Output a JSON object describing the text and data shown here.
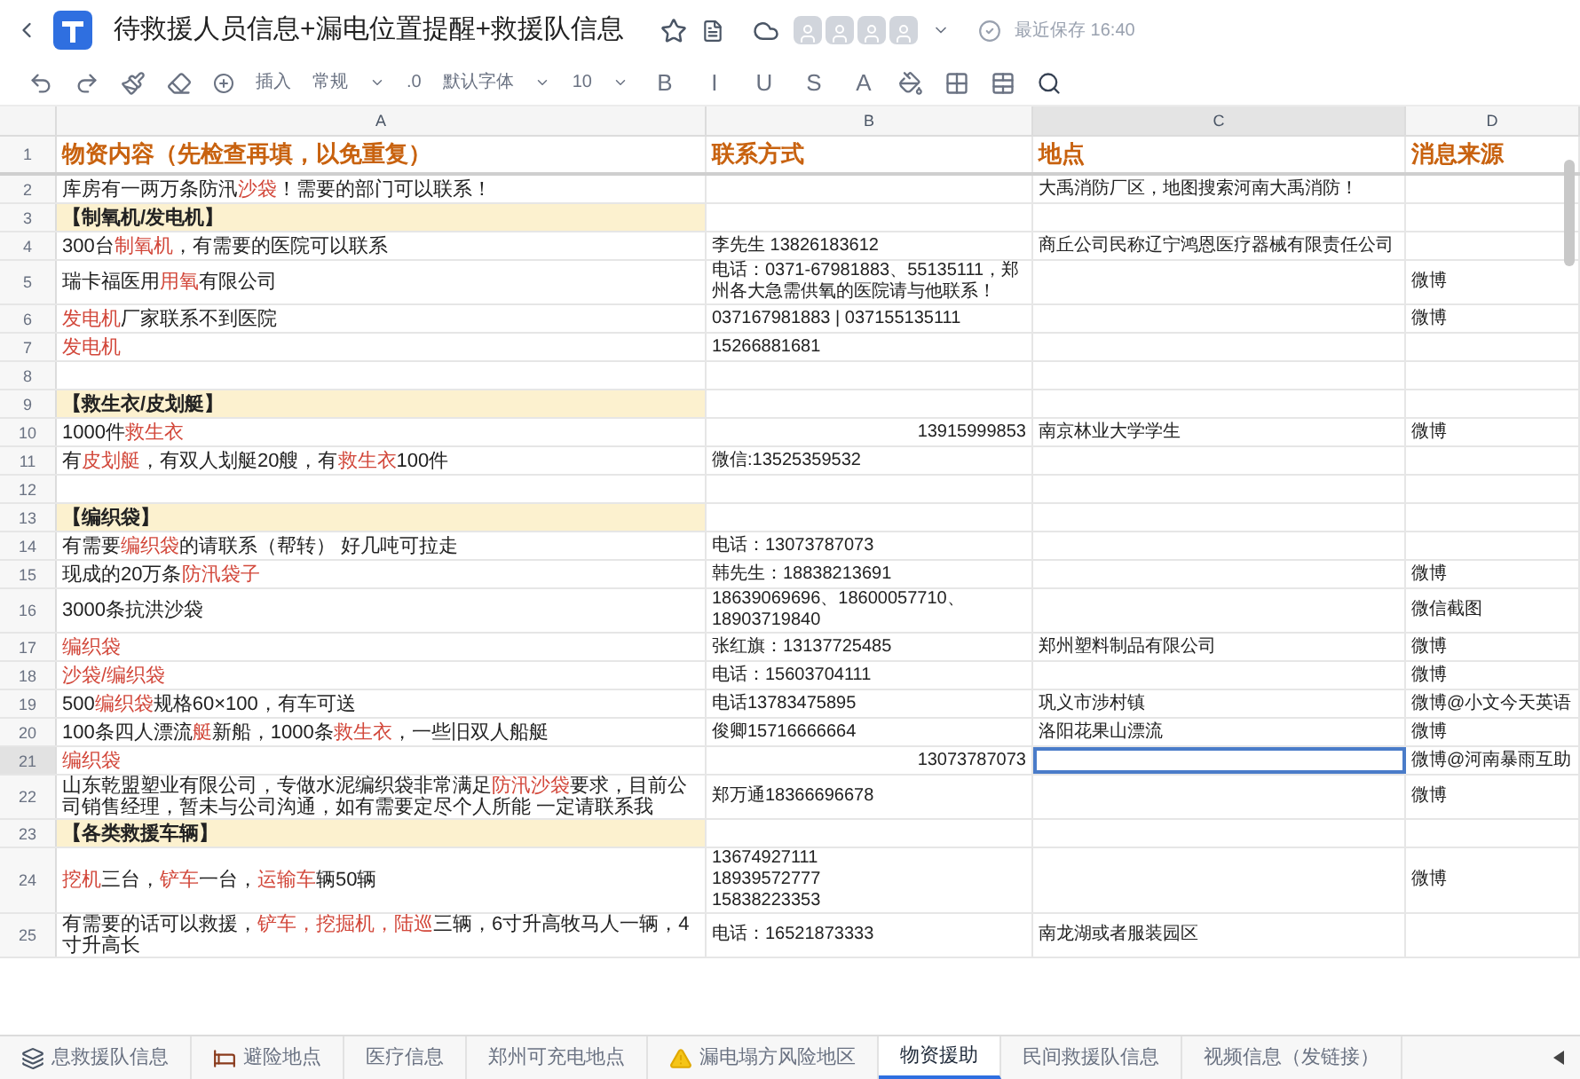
{
  "document": {
    "title": "待救援人员信息+漏电位置提醒+救援队信息",
    "save_status": "最近保存 16:40"
  },
  "toolbar": {
    "disabled": true,
    "insert": "插入",
    "number_format": "常规",
    "decimal": ".0",
    "font": "默认字体",
    "font_size": "10",
    "format_letters": [
      "B",
      "I",
      "U",
      "S",
      "A"
    ]
  },
  "columns": [
    {
      "letter": "A",
      "selected": false
    },
    {
      "letter": "B",
      "selected": false
    },
    {
      "letter": "C",
      "selected": true
    },
    {
      "letter": "D",
      "selected": false
    }
  ],
  "rows": [
    {
      "number": "1",
      "kind": "header",
      "selected": false,
      "a": "物资内容（先检查再填，以免重复）",
      "b": "联系方式",
      "c": "地点",
      "d": "消息来源"
    },
    {
      "number": "2",
      "kind": "plain",
      "selected": false,
      "a": [
        {
          "text": "库房有一两万条防汛",
          "highlighted": false
        },
        {
          "text": "沙袋",
          "highlighted": true
        },
        {
          "text": "！需要的部门可以联系！",
          "highlighted": false
        }
      ],
      "c": "大禹消防厂区，地图搜索河南大禹消防！"
    },
    {
      "number": "3",
      "kind": "section",
      "selected": false,
      "a": "【制氧机/发电机】"
    },
    {
      "number": "4",
      "kind": "plain",
      "selected": false,
      "a": [
        {
          "text": "300台",
          "highlighted": false
        },
        {
          "text": "制氧机",
          "highlighted": true
        },
        {
          "text": "，有需要的医院可以联系",
          "highlighted": false
        }
      ],
      "b": "李先生 13826183612",
      "c": "商丘公司民称辽宁鸿恩医疗器械有限责任公司"
    },
    {
      "number": "5",
      "kind": "plain",
      "selected": false,
      "a": [
        {
          "text": "瑞卡福医用",
          "highlighted": false
        },
        {
          "text": "用氧",
          "highlighted": true
        },
        {
          "text": "有限公司",
          "highlighted": false
        }
      ],
      "b": "电话：0371-67981883、55135111，郑州各大急需供氧的医院请与他联系！",
      "d": "微博"
    },
    {
      "number": "6",
      "kind": "plain",
      "selected": false,
      "a": [
        {
          "text": "发电机",
          "highlighted": true
        },
        {
          "text": "厂家联系不到医院",
          "highlighted": false
        }
      ],
      "b": "037167981883 | 037155135111",
      "d": "微博"
    },
    {
      "number": "7",
      "kind": "plain",
      "selected": false,
      "a": [
        {
          "text": "发电机",
          "highlighted": true
        }
      ],
      "b": "15266881681"
    },
    {
      "number": "8",
      "kind": "plain",
      "selected": false
    },
    {
      "number": "9",
      "kind": "section",
      "selected": false,
      "a": "【救生衣/皮划艇】"
    },
    {
      "number": "10",
      "kind": "plain",
      "selected": false,
      "a": [
        {
          "text": "1000件",
          "highlighted": false
        },
        {
          "text": "救生衣",
          "highlighted": true
        }
      ],
      "b": "13915999853",
      "b_numeric": true,
      "c": "南京林业大学学生",
      "d": "微博"
    },
    {
      "number": "11",
      "kind": "plain",
      "selected": false,
      "a": [
        {
          "text": "有",
          "highlighted": false
        },
        {
          "text": "皮划艇",
          "highlighted": true
        },
        {
          "text": "，有双人划艇20艘，有",
          "highlighted": false
        },
        {
          "text": "救生衣",
          "highlighted": true
        },
        {
          "text": "100件",
          "highlighted": false
        }
      ],
      "b": "微信:13525359532"
    },
    {
      "number": "12",
      "kind": "plain",
      "selected": false
    },
    {
      "number": "13",
      "kind": "section",
      "selected": false,
      "a": "【编织袋】"
    },
    {
      "number": "14",
      "kind": "plain",
      "selected": false,
      "a": [
        {
          "text": "有需要",
          "highlighted": false
        },
        {
          "text": "编织袋",
          "highlighted": true
        },
        {
          "text": "的请联系（帮转） 好几吨可拉走",
          "highlighted": false
        }
      ],
      "b": "电话：13073787073"
    },
    {
      "number": "15",
      "kind": "plain",
      "selected": false,
      "a": [
        {
          "text": "现成的20万条",
          "highlighted": false
        },
        {
          "text": "防汛袋子",
          "highlighted": true
        }
      ],
      "b": "韩先生：18838213691",
      "d": "微博"
    },
    {
      "number": "16",
      "kind": "plain",
      "selected": false,
      "a": "3000条抗洪沙袋",
      "b": "18639069696、18600057710、18903719840",
      "d": "微信截图"
    },
    {
      "number": "17",
      "kind": "plain",
      "selected": false,
      "a": [
        {
          "text": "编织袋",
          "highlighted": true
        }
      ],
      "b": "张红旗：13137725485",
      "c": "郑州塑料制品有限公司",
      "d": "微博"
    },
    {
      "number": "18",
      "kind": "plain",
      "selected": false,
      "a": [
        {
          "text": "沙袋/编织袋",
          "highlighted": true
        }
      ],
      "b": "电话：15603704111",
      "d": "微博"
    },
    {
      "number": "19",
      "kind": "plain",
      "selected": false,
      "a": [
        {
          "text": "500",
          "highlighted": false
        },
        {
          "text": "编织袋",
          "highlighted": true
        },
        {
          "text": "规格60×100，有车可送",
          "highlighted": false
        }
      ],
      "b": "电话13783475895",
      "c": "巩义市涉村镇",
      "d": "微博@小文今天英语"
    },
    {
      "number": "20",
      "kind": "plain",
      "selected": false,
      "a": [
        {
          "text": "100条四人漂流",
          "highlighted": false
        },
        {
          "text": "艇",
          "highlighted": true
        },
        {
          "text": "新船，1000条",
          "highlighted": false
        },
        {
          "text": "救生衣",
          "highlighted": true
        },
        {
          "text": "，一些旧双人船艇",
          "highlighted": false
        }
      ],
      "b": "俊卿15716666664",
      "c": "洛阳花果山漂流",
      "d": "微博"
    },
    {
      "number": "21",
      "kind": "plain",
      "selected": true,
      "a": [
        {
          "text": "编织袋",
          "highlighted": true
        }
      ],
      "b": "13073787073",
      "b_numeric": true,
      "d": "微博@河南暴雨互助"
    },
    {
      "number": "22",
      "kind": "plain",
      "selected": false,
      "a": [
        {
          "text": "山东乾盟塑业有限公司，专做水泥编织袋非常满足",
          "highlighted": false
        },
        {
          "text": "防汛沙袋",
          "highlighted": true
        },
        {
          "text": "要求，目前公司销售经理，暂未与公司沟通，如有需要定尽个人所能 一定请联系我",
          "highlighted": false
        }
      ],
      "b": "郑万通18366696678",
      "d": "微博"
    },
    {
      "number": "23",
      "kind": "section",
      "selected": false,
      "a": "【各类救援车辆】"
    },
    {
      "number": "24",
      "kind": "plain",
      "selected": false,
      "a": [
        {
          "text": "挖机",
          "highlighted": true
        },
        {
          "text": "三台，",
          "highlighted": false
        },
        {
          "text": "铲车",
          "highlighted": true
        },
        {
          "text": "一台，",
          "highlighted": false
        },
        {
          "text": "运输车",
          "highlighted": true
        },
        {
          "text": "辆50辆",
          "highlighted": false
        }
      ],
      "b": "13674927111\n18939572777\n15838223353",
      "d": "微博"
    },
    {
      "number": "25",
      "kind": "plain",
      "selected": false,
      "a": [
        {
          "text": "有需要的话可以救援，",
          "highlighted": false
        },
        {
          "text": "铲车，挖掘机，陆巡",
          "highlighted": true
        },
        {
          "text": "三辆，6寸升高牧马人一辆，4寸升高长",
          "highlighted": false
        }
      ],
      "b": "电话：16521873333",
      "c": "南龙湖或者服装园区"
    }
  ],
  "sheet_tabs": [
    {
      "label": "息救援队信息",
      "kind": "stack",
      "selected": false
    },
    {
      "label": "避险地点",
      "kind": "bed",
      "selected": false
    },
    {
      "label": "医疗信息",
      "kind": "plain",
      "selected": false
    },
    {
      "label": "郑州可充电地点",
      "kind": "plain",
      "selected": false
    },
    {
      "label": "漏电塌方风险地区",
      "kind": "warning",
      "selected": false
    },
    {
      "label": "物资援助",
      "kind": "plain",
      "selected": true
    },
    {
      "label": "民间救援队信息",
      "kind": "plain",
      "selected": false
    },
    {
      "label": "视频信息（发链接）",
      "kind": "plain",
      "selected": false
    }
  ]
}
